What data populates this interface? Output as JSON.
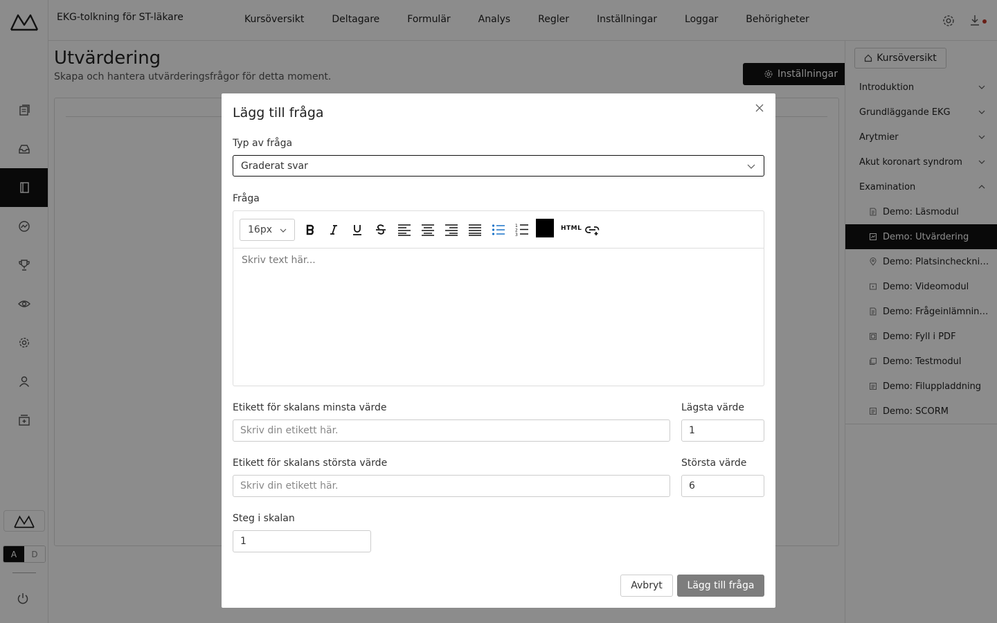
{
  "app": {
    "course_title": "EKG-tolkning för ST-läkare",
    "top_nav": [
      "Kursöversikt",
      "Deltagare",
      "Formulär",
      "Analys",
      "Regler",
      "Inställningar",
      "Loggar",
      "Behörigheter"
    ],
    "mode_toggle": {
      "a": "A",
      "d": "D"
    }
  },
  "page": {
    "title": "Utvärdering",
    "subtitle": "Skapa och hantera utvärderingsfrågor för detta moment.",
    "settings_button": "Inställningar"
  },
  "sidebar": {
    "overview_button": "Kursöversikt",
    "sections": [
      "Introduktion",
      "Grundläggande EKG",
      "Arytmier",
      "Akut koronart syndrom",
      "Examination"
    ],
    "items": [
      {
        "label": "Demo: Läsmodul",
        "icon": "document-icon"
      },
      {
        "label": "Demo: Utvärdering",
        "icon": "evaluation-icon"
      },
      {
        "label": "Demo: Platsincheckni…",
        "icon": "location-icon"
      },
      {
        "label": "Demo: Videomodul",
        "icon": "video-icon"
      },
      {
        "label": "Demo: Frågeinlämnin…",
        "icon": "document-icon"
      },
      {
        "label": "Demo: Fyll i PDF",
        "icon": "pdf-icon"
      },
      {
        "label": "Demo: Testmodul",
        "icon": "test-icon"
      },
      {
        "label": "Demo: Filuppladdning",
        "icon": "list-icon"
      },
      {
        "label": "Demo: SCORM",
        "icon": "list-icon"
      }
    ]
  },
  "modal": {
    "title": "Lägg till fråga",
    "type_label": "Typ av fråga",
    "type_value": "Graderat svar",
    "question_label": "Fråga",
    "font_size": "16px",
    "editor_placeholder": "Skriv text här...",
    "html_button": "HTML",
    "min_label_label": "Etikett för skalans minsta värde",
    "min_label_placeholder": "Skriv din etikett här.",
    "min_value_label": "Lägsta värde",
    "min_value": "1",
    "max_label_label": "Etikett för skalans största värde",
    "max_label_placeholder": "Skriv din etikett här.",
    "max_value_label": "Största värde",
    "max_value": "6",
    "step_label": "Steg i skalan",
    "step_value": "1",
    "cancel_button": "Avbryt",
    "add_button": "Lägg till fråga"
  }
}
